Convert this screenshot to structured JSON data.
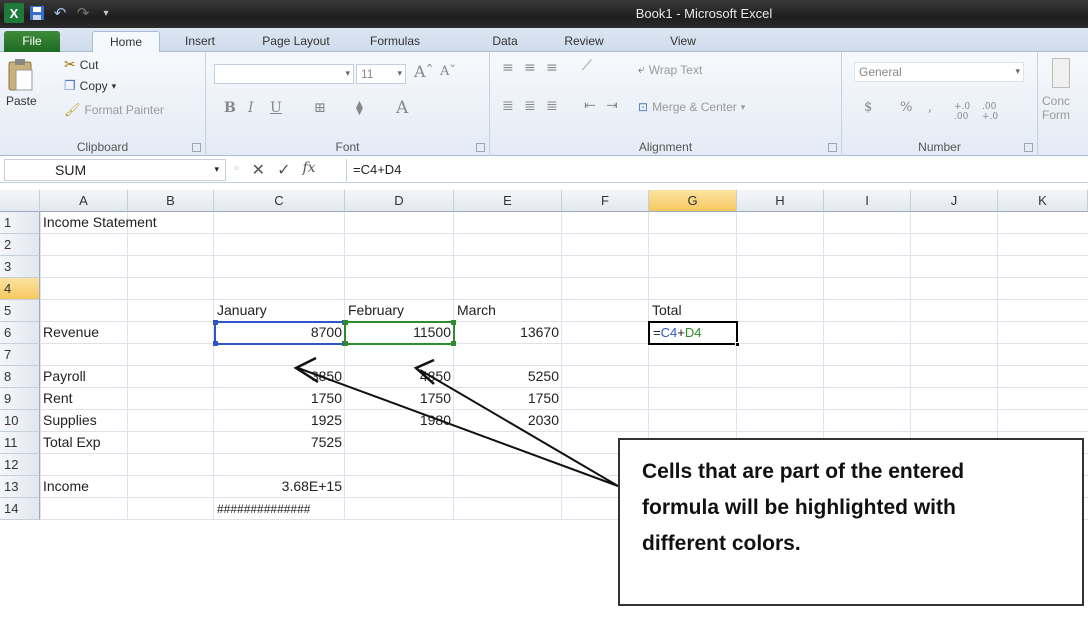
{
  "window": {
    "title": "Book1 - Microsoft Excel"
  },
  "tabs": [
    {
      "label": "File"
    },
    {
      "label": "Home"
    },
    {
      "label": "Insert"
    },
    {
      "label": "Page Layout"
    },
    {
      "label": "Formulas"
    },
    {
      "label": "Data"
    },
    {
      "label": "Review"
    },
    {
      "label": "View"
    }
  ],
  "active_tab": "Home",
  "ribbon": {
    "clipboard": {
      "paste": "Paste",
      "cut": "Cut",
      "copy": "Copy",
      "format_painter": "Format Painter",
      "label": "Clipboard"
    },
    "font": {
      "size": "11",
      "label": "Font"
    },
    "alignment": {
      "wrap_text": "Wrap Text",
      "merge_center": "Merge & Center",
      "label": "Alignment"
    },
    "number": {
      "format": "General",
      "currency": "$",
      "percent": "%",
      "comma": ",",
      "inc_decimal": "+.0 .00",
      "dec_decimal": ".00 +.0",
      "label": "Number"
    },
    "styles": {
      "conditional": "Conc",
      "format": "Form"
    }
  },
  "formula_bar": {
    "name_box": "SUM",
    "formula": "=C4+D4",
    "fx": "fx"
  },
  "columns": [
    "A",
    "B",
    "C",
    "D",
    "E",
    "F",
    "G",
    "H",
    "I",
    "J",
    "K"
  ],
  "selected_column": "G",
  "rows": [
    "1",
    "2",
    "3",
    "4",
    "5",
    "6",
    "7",
    "8",
    "9",
    "10",
    "11",
    "12",
    "13",
    "14"
  ],
  "selected_row": "4",
  "cells": {
    "A1": "Income Statement",
    "C3": "January",
    "D3": "February",
    "E3": "March",
    "G3": "Total",
    "A4": "Revenue",
    "C4": "8700",
    "D4": "11500",
    "E4": "13670",
    "A6": "Payroll",
    "C6": "3850",
    "D6": "4850",
    "E6": "5250",
    "A7": "Rent",
    "C7": "1750",
    "D7": "1750",
    "E7": "1750",
    "A8": "Supplies",
    "C8": "1925",
    "D8": "1980",
    "E8": "2030",
    "A9": "Total Exp",
    "C9": "7525",
    "A11": "Income",
    "C11": "3.68E+15",
    "C13": "##############"
  },
  "active_cell_formula": {
    "eq": "=",
    "ref1": "C4",
    "plus": "+",
    "ref2": "D4"
  },
  "colors": {
    "ref1": "#2f55c6",
    "ref2": "#2e8b2e"
  },
  "callout": {
    "line1": "Cells that are part of the entered",
    "line2": "formula will be highlighted with",
    "line3": "different colors."
  }
}
